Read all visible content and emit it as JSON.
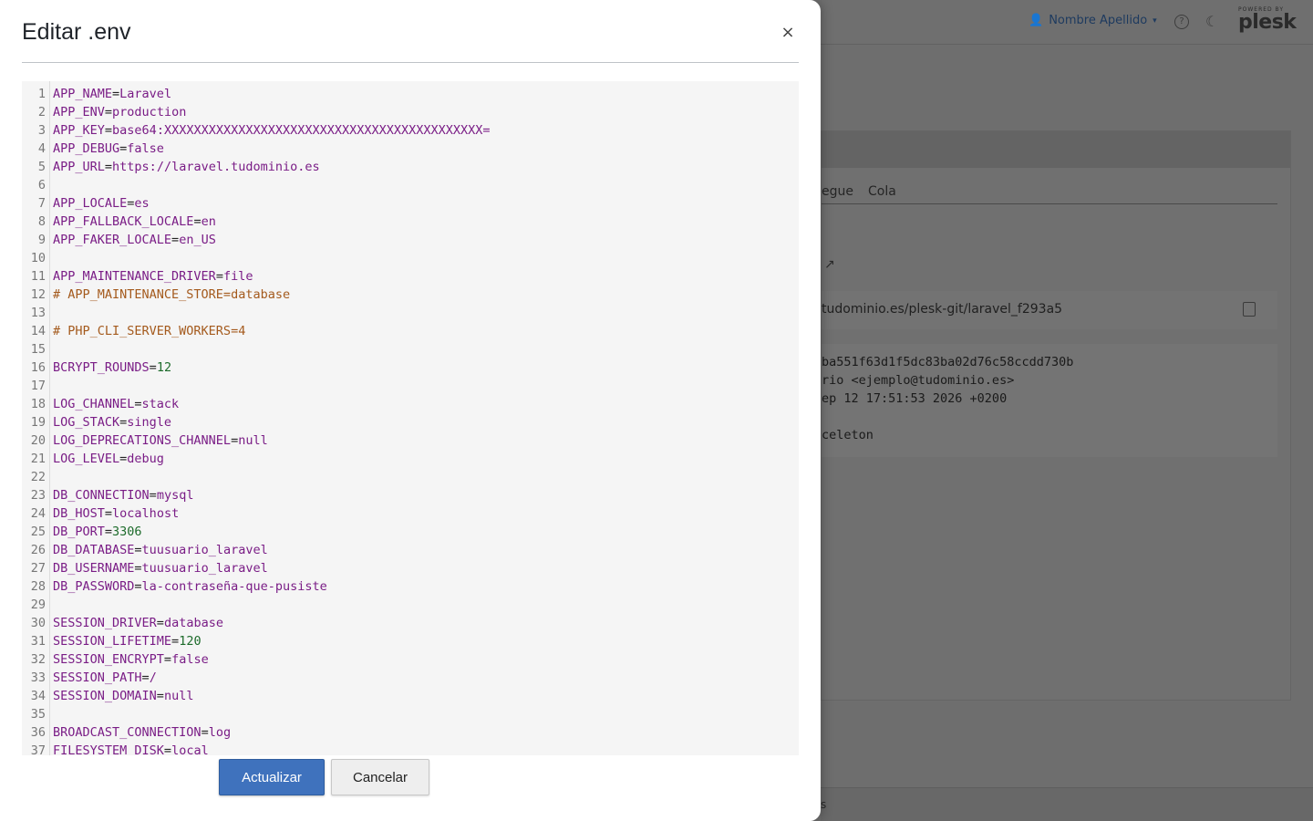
{
  "background": {
    "user_name": "Nombre Apellido",
    "help_icon": "question-circle-icon",
    "theme_icon": "moon-icon",
    "brand_small": "POWERED BY",
    "brand_name": "plesk",
    "tabs": [
      "egue",
      "Cola"
    ],
    "external_link_icon": "external-link-icon",
    "repo_url": "tudominio.es/plesk-git/laravel_f293a5",
    "copy_icon": "copy-icon",
    "commit_lines": [
      "ba551f63d1f5dc83ba02d76c58ccdd730b",
      "rio <ejemplo@tudominio.es>",
      "ep 12 17:51:53 2026 +0200",
      "",
      "celeton"
    ],
    "footer_text": "s"
  },
  "modal": {
    "title": "Editar .env",
    "close_icon": "close-icon",
    "close_symbol": "×",
    "update_button": "Actualizar",
    "cancel_button": "Cancelar"
  },
  "editor": {
    "lines": [
      "APP_NAME=Laravel",
      "APP_ENV=production",
      "APP_KEY=base64:XXXXXXXXXXXXXXXXXXXXXXXXXXXXXXXXXXXXXXXXXXX=",
      "APP_DEBUG=false",
      "APP_URL=https://laravel.tudominio.es",
      "",
      "APP_LOCALE=es",
      "APP_FALLBACK_LOCALE=en",
      "APP_FAKER_LOCALE=en_US",
      "",
      "APP_MAINTENANCE_DRIVER=file",
      "# APP_MAINTENANCE_STORE=database",
      "",
      "# PHP_CLI_SERVER_WORKERS=4",
      "",
      "BCRYPT_ROUNDS=12",
      "",
      "LOG_CHANNEL=stack",
      "LOG_STACK=single",
      "LOG_DEPRECATIONS_CHANNEL=null",
      "LOG_LEVEL=debug",
      "",
      "DB_CONNECTION=mysql",
      "DB_HOST=localhost",
      "DB_PORT=3306",
      "DB_DATABASE=tuusuario_laravel",
      "DB_USERNAME=tuusuario_laravel",
      "DB_PASSWORD=la-contraseña-que-pusiste",
      "",
      "SESSION_DRIVER=database",
      "SESSION_LIFETIME=120",
      "SESSION_ENCRYPT=false",
      "SESSION_PATH=/",
      "SESSION_DOMAIN=null",
      "",
      "BROADCAST_CONNECTION=log",
      "FILESYSTEM_DISK=local"
    ]
  }
}
